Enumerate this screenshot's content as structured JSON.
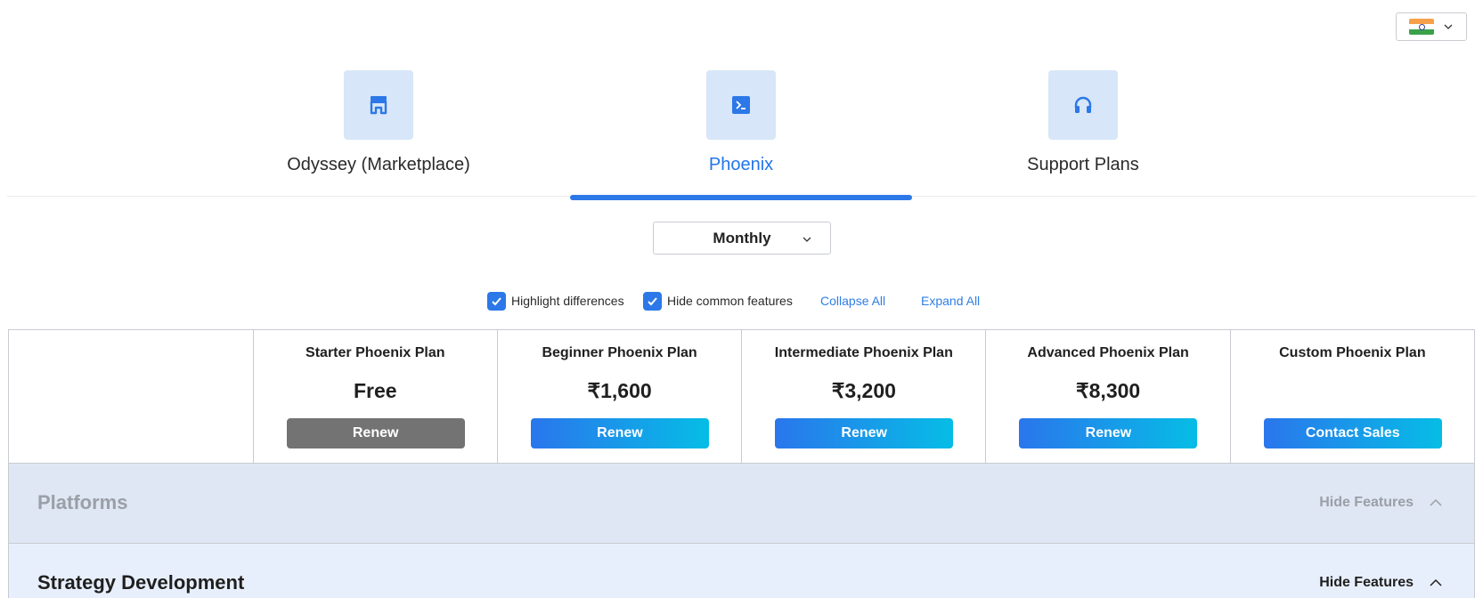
{
  "language": {
    "flag": "india-flag-icon",
    "chevron": "chevron-down-icon"
  },
  "tabs": [
    {
      "label": "Odyssey (Marketplace)",
      "icon": "store-icon",
      "active": false
    },
    {
      "label": "Phoenix",
      "icon": "terminal-icon",
      "active": true
    },
    {
      "label": "Support Plans",
      "icon": "headphones-icon",
      "active": false
    }
  ],
  "billing": {
    "value": "Monthly"
  },
  "options": {
    "highlight_label": "Highlight differences",
    "highlight_checked": true,
    "hide_common_label": "Hide common features",
    "hide_common_checked": true,
    "collapse_all": "Collapse All",
    "expand_all": "Expand All"
  },
  "plans": [
    {
      "name": "Starter Phoenix Plan",
      "price": "Free",
      "button": "Renew",
      "button_style": "grey"
    },
    {
      "name": "Beginner Phoenix Plan",
      "price": "₹1,600",
      "button": "Renew",
      "button_style": "gradient"
    },
    {
      "name": "Intermediate Phoenix Plan",
      "price": "₹3,200",
      "button": "Renew",
      "button_style": "gradient"
    },
    {
      "name": "Advanced Phoenix Plan",
      "price": "₹8,300",
      "button": "Renew",
      "button_style": "gradient"
    },
    {
      "name": "Custom Phoenix Plan",
      "price": "",
      "button": "Contact Sales",
      "button_style": "gradient"
    }
  ],
  "sections": [
    {
      "title": "Platforms",
      "toggle": "Hide Features",
      "muted": true
    },
    {
      "title": "Strategy Development",
      "toggle": "Hide Features",
      "muted": false
    }
  ],
  "colors": {
    "accent": "#2c78e8",
    "button_gradient_start": "#2a76ec",
    "button_gradient_end": "#06bde6",
    "button_grey": "#737373",
    "icon_tile": "#d7e6f8"
  }
}
